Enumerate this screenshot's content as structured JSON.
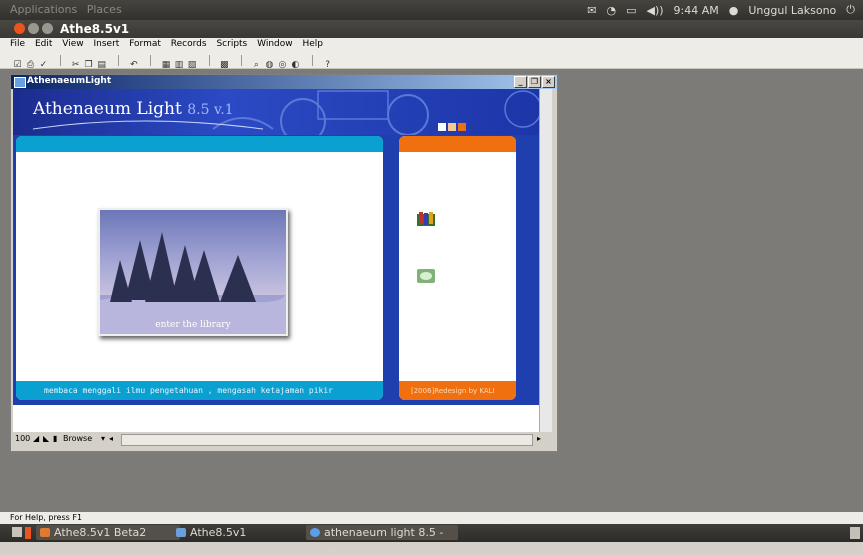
{
  "topPanel": {
    "menu": [
      "Applications",
      "Places"
    ],
    "time": "9:44 AM",
    "user": "Unggul Laksono"
  },
  "app": {
    "title": "Athe8.5v1",
    "menu": [
      "File",
      "Edit",
      "View",
      "Insert",
      "Format",
      "Records",
      "Scripts",
      "Window",
      "Help"
    ]
  },
  "child": {
    "title": "AthenaeumLight",
    "banner_title": "Athenaeum Light",
    "banner_version": "8.5 v.1",
    "image_caption": "enter the library",
    "footer_text": "membaca menggali ilmu pengetahuan , mengasah ketajaman pikir",
    "side_footer_text": "[2006]Redesign by KALI",
    "zoom": "100",
    "mode": "Browse"
  },
  "status": {
    "help_text": "For Help, press F1"
  },
  "taskbar": {
    "items": [
      "Athe8.5v1 Beta2",
      "Athe8.5v1",
      "athenaeum light 8.5 - ..."
    ]
  },
  "colors": {
    "banner_blue": "#1f3fae",
    "cyan_bar": "#0aa0d0",
    "orange_bar": "#f07010"
  }
}
